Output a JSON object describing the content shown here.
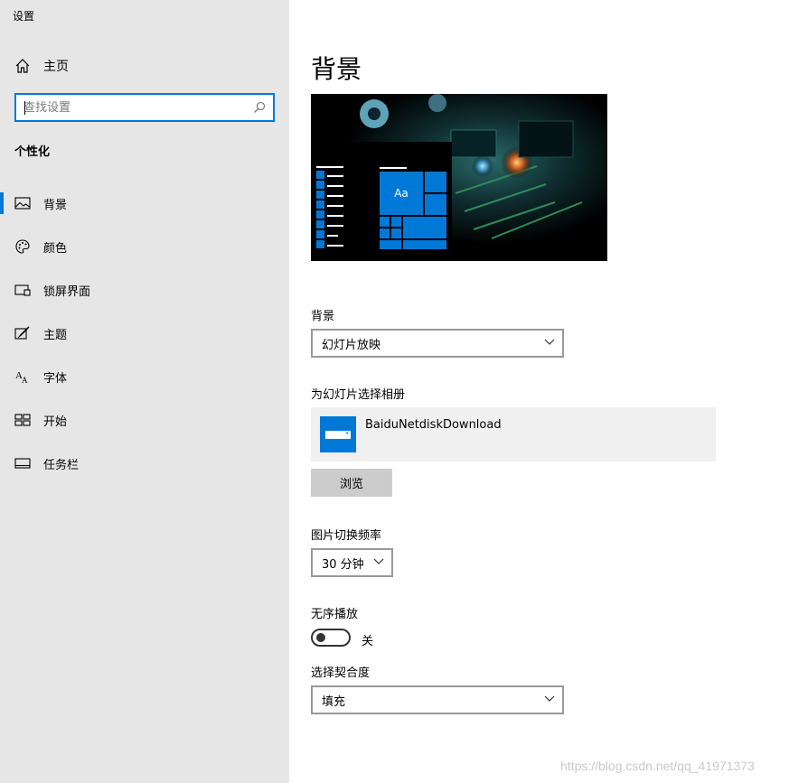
{
  "window": {
    "title": "设置"
  },
  "sidebar": {
    "home_label": "主页",
    "search_placeholder": "查找设置",
    "section_title": "个性化",
    "items": [
      {
        "label": "背景",
        "icon": "picture-icon",
        "active": true
      },
      {
        "label": "颜色",
        "icon": "palette-icon",
        "active": false
      },
      {
        "label": "锁屏界面",
        "icon": "lock-screen-icon",
        "active": false
      },
      {
        "label": "主题",
        "icon": "theme-brush-icon",
        "active": false
      },
      {
        "label": "字体",
        "icon": "font-icon",
        "active": false
      },
      {
        "label": "开始",
        "icon": "start-tiles-icon",
        "active": false
      },
      {
        "label": "任务栏",
        "icon": "taskbar-icon",
        "active": false
      }
    ]
  },
  "main": {
    "title": "背景",
    "preview_tile_text": "Aa",
    "background_label": "背景",
    "background_value": "幻灯片放映",
    "album_label": "为幻灯片选择相册",
    "album_name": "BaiduNetdiskDownload",
    "browse_label": "浏览",
    "interval_label": "图片切换频率",
    "interval_value": "30 分钟",
    "shuffle_label": "无序播放",
    "shuffle_state": "关",
    "fit_label": "选择契合度",
    "fit_value": "填充"
  },
  "watermark": "https://blog.csdn.net/qq_41971373",
  "colors": {
    "accent": "#0078d7",
    "sidebar_bg": "#e6e6e6",
    "album_bg": "#f0f0f0",
    "button_bg": "#cccccc"
  }
}
